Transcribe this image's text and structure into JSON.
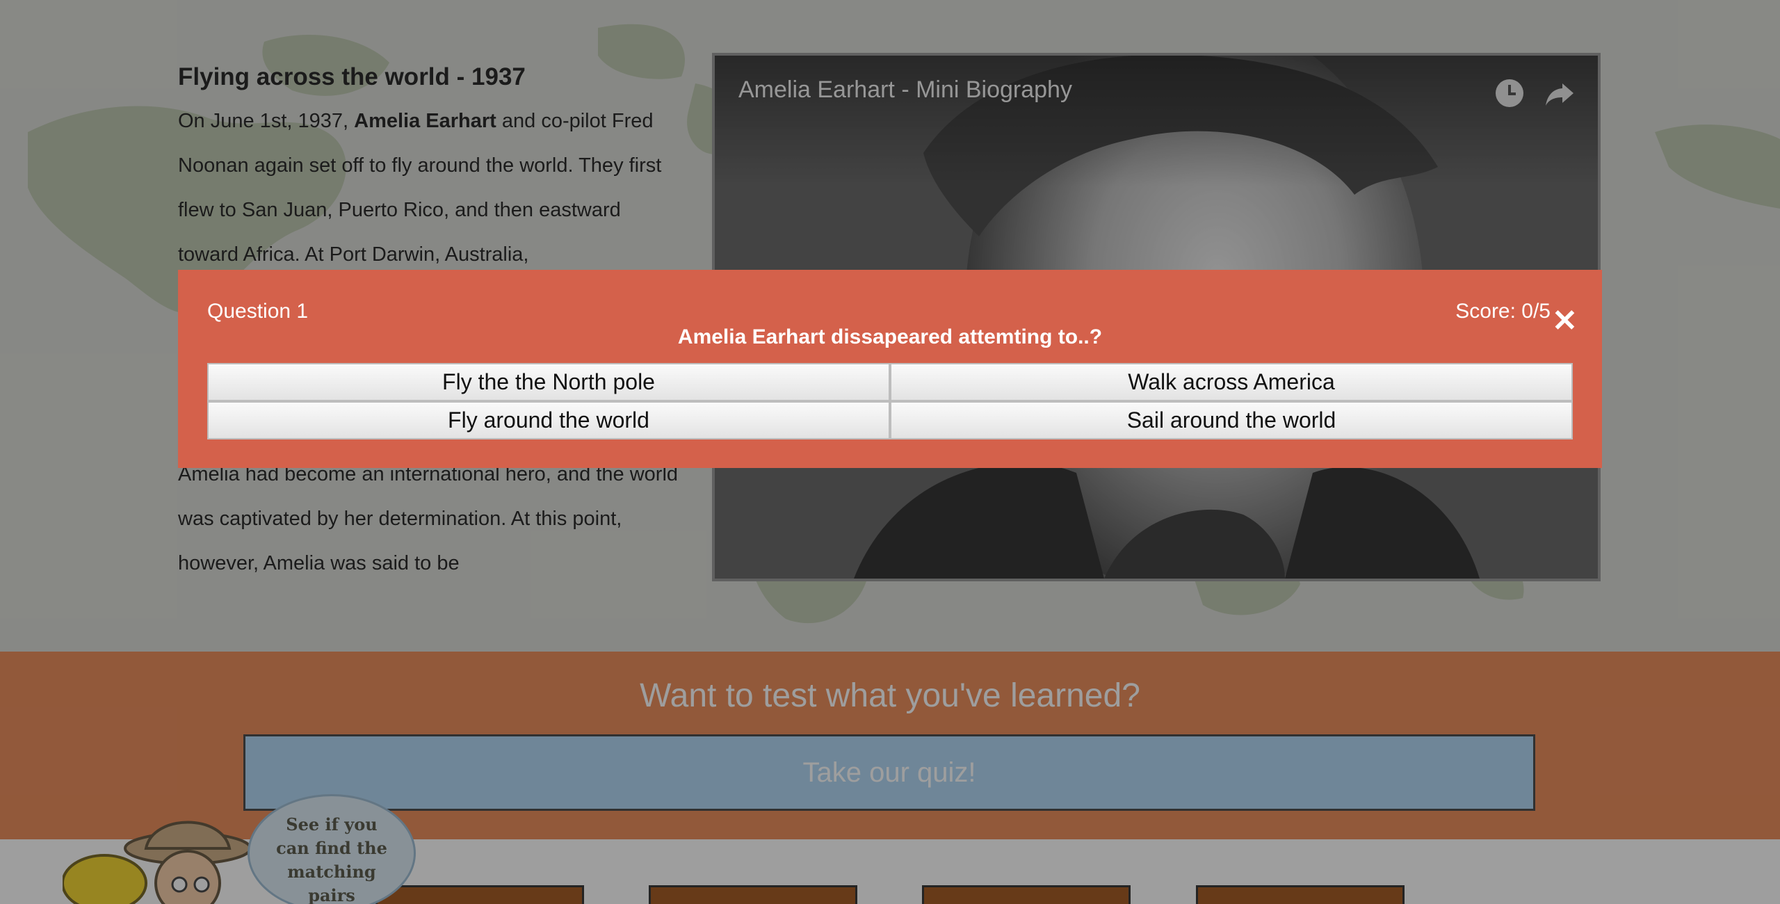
{
  "article": {
    "heading": "Flying across the world - 1937",
    "para_pre": "On June 1st, 1937, ",
    "para_bold": "Amelia Earhart",
    "para_post": " and co-pilot Fred Noonan again set off to fly around the world. They first flew to San Juan, Puerto Rico, and then eastward toward Africa. At Port Darwin, Australia,",
    "para_lower": "Amelia had become an international hero, and the world was captivated by her determination. At this point, however, Amelia was said to be"
  },
  "video": {
    "title": "Amelia Earhart - Mini Biography",
    "icons": [
      "clock-icon",
      "share-icon"
    ]
  },
  "quiz_section": {
    "heading": "Want to test what you've learned?",
    "button_label": "Take our quiz!"
  },
  "mascot": {
    "bubble_text": "See if you can find the matching pairs"
  },
  "modal": {
    "question_number": "Question 1",
    "score": "Score: 0/5",
    "question": "Amelia Earhart dissapeared attemting to..?",
    "answers": [
      "Fly the the North pole",
      "Walk across America",
      "Fly around the world",
      "Sail around the world"
    ],
    "close_icon": "close-icon",
    "colors": {
      "modal_bg": "#d4614b",
      "answer_bg": "#f0f0f0"
    }
  }
}
